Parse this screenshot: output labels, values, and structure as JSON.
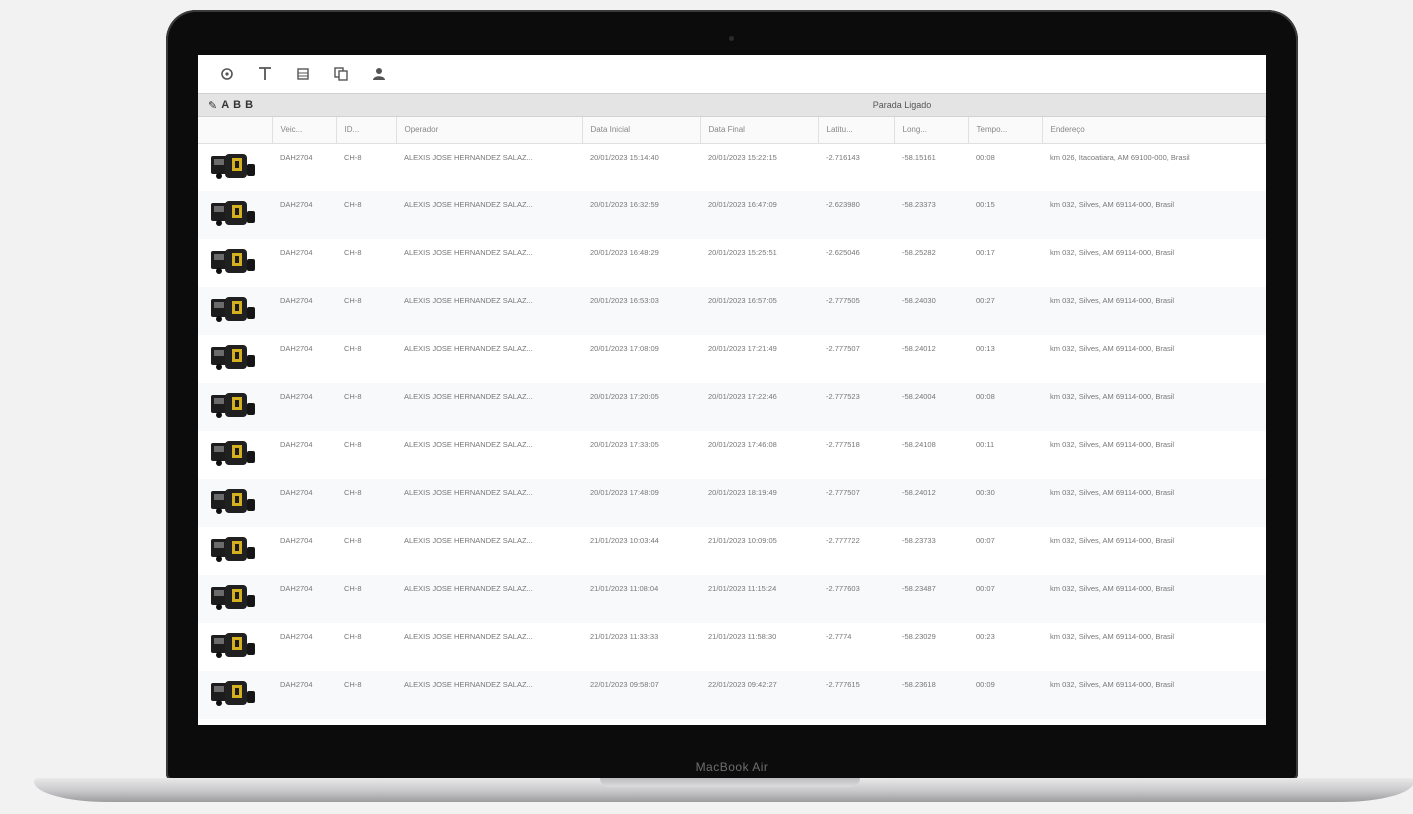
{
  "device": {
    "label": "MacBook Air"
  },
  "toolbar": {
    "buttons": [
      {
        "icon": "settings-icon"
      },
      {
        "icon": "filter-icon"
      },
      {
        "icon": "calendar-icon"
      },
      {
        "icon": "copy-icon"
      },
      {
        "icon": "user-icon"
      }
    ]
  },
  "strip": {
    "tools": [
      "✎",
      "A",
      "B",
      "B"
    ],
    "title": "Parada Ligado"
  },
  "table": {
    "headers": [
      "",
      "Veic...",
      "ID...",
      "Operador",
      "Data Inicial",
      "Data Final",
      "Latitu...",
      "Long...",
      "Tempo...",
      "Endereço"
    ],
    "rows": [
      [
        "DAH2704",
        "CH-8",
        "ALEXIS JOSE HERNANDEZ SALAZ...",
        "20/01/2023 15:14:40",
        "20/01/2023 15:22:15",
        "-2.716143",
        "-58.15161",
        "00:08",
        "km 026, Itacoatiara, AM 69100-000, Brasil"
      ],
      [
        "DAH2704",
        "CH-8",
        "ALEXIS JOSE HERNANDEZ SALAZ...",
        "20/01/2023 16:32:59",
        "20/01/2023 16:47:09",
        "-2.623980",
        "-58.23373",
        "00:15",
        "km 032, Silves, AM 69114-000, Brasil"
      ],
      [
        "DAH2704",
        "CH-8",
        "ALEXIS JOSE HERNANDEZ SALAZ...",
        "20/01/2023 16:48:29",
        "20/01/2023 15:25:51",
        "-2.625046",
        "-58.25282",
        "00:17",
        "km 032, Silves, AM 69114-000, Brasil"
      ],
      [
        "DAH2704",
        "CH-8",
        "ALEXIS JOSE HERNANDEZ SALAZ...",
        "20/01/2023 16:53:03",
        "20/01/2023 16:57:05",
        "-2.777505",
        "-58.24030",
        "00:27",
        "km 032, Silves, AM 69114-000, Brasil"
      ],
      [
        "DAH2704",
        "CH-8",
        "ALEXIS JOSE HERNANDEZ SALAZ...",
        "20/01/2023 17:08:09",
        "20/01/2023 17:21:49",
        "-2.777507",
        "-58.24012",
        "00:13",
        "km 032, Silves, AM 69114-000, Brasil"
      ],
      [
        "DAH2704",
        "CH-8",
        "ALEXIS JOSE HERNANDEZ SALAZ...",
        "20/01/2023 17:20:05",
        "20/01/2023 17:22:46",
        "-2.777523",
        "-58.24004",
        "00:08",
        "km 032, Silves, AM 69114-000, Brasil"
      ],
      [
        "DAH2704",
        "CH-8",
        "ALEXIS JOSE HERNANDEZ SALAZ...",
        "20/01/2023 17:33:05",
        "20/01/2023 17:46:08",
        "-2.777518",
        "-58.24108",
        "00:11",
        "km 032, Silves, AM 69114-000, Brasil"
      ],
      [
        "DAH2704",
        "CH-8",
        "ALEXIS JOSE HERNANDEZ SALAZ...",
        "20/01/2023 17:48:09",
        "20/01/2023 18:19:49",
        "-2.777507",
        "-58.24012",
        "00:30",
        "km 032, Silves, AM 69114-000, Brasil"
      ],
      [
        "DAH2704",
        "CH-8",
        "ALEXIS JOSE HERNANDEZ SALAZ...",
        "21/01/2023 10:03:44",
        "21/01/2023 10:09:05",
        "-2.777722",
        "-58.23733",
        "00:07",
        "km 032, Silves, AM 69114-000, Brasil"
      ],
      [
        "DAH2704",
        "CH-8",
        "ALEXIS JOSE HERNANDEZ SALAZ...",
        "21/01/2023 11:08:04",
        "21/01/2023 11:15:24",
        "-2.777603",
        "-58.23487",
        "00:07",
        "km 032, Silves, AM 69114-000, Brasil"
      ],
      [
        "DAH2704",
        "CH-8",
        "ALEXIS JOSE HERNANDEZ SALAZ...",
        "21/01/2023 11:33:33",
        "21/01/2023 11:58:30",
        "-2.7774",
        "-58.23029",
        "00:23",
        "km 032, Silves, AM 69114-000, Brasil"
      ],
      [
        "DAH2704",
        "CH-8",
        "ALEXIS JOSE HERNANDEZ SALAZ...",
        "22/01/2023 09:58:07",
        "22/01/2023 09:42:27",
        "-2.777615",
        "-58.23618",
        "00:09",
        "km 032, Silves, AM 69114-000, Brasil"
      ]
    ]
  },
  "colors": {
    "accent": "#d4b020",
    "machine": "#1c1c1c"
  }
}
